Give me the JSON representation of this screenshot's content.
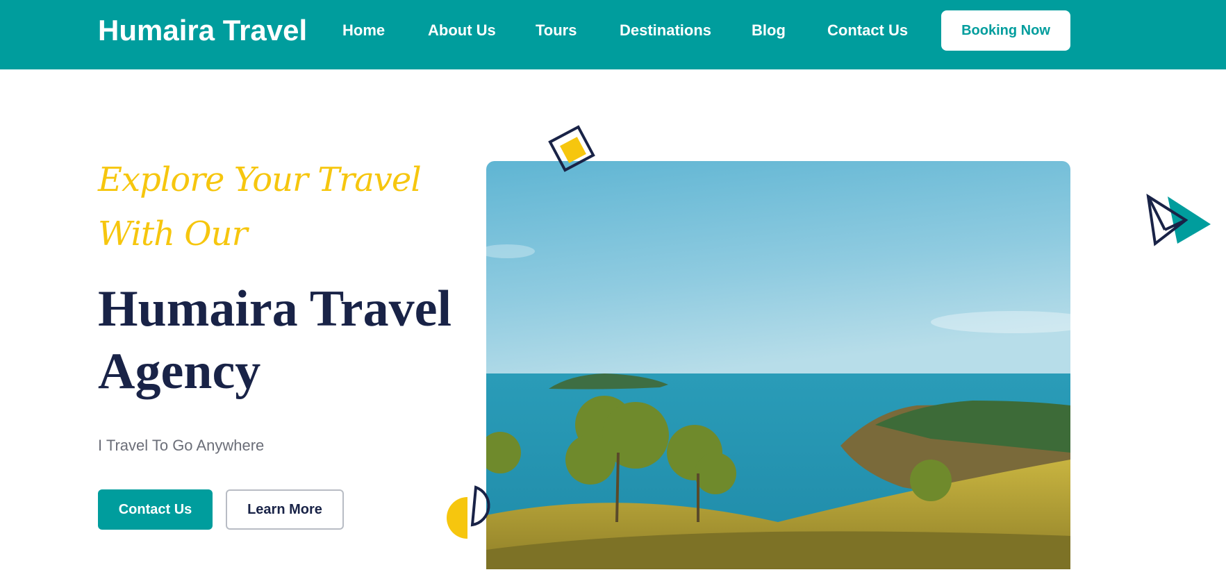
{
  "header": {
    "brand": "Humaira Travel",
    "nav": [
      {
        "label": "Home"
      },
      {
        "label": "About Us"
      },
      {
        "label": "Tours"
      },
      {
        "label": "Destinations"
      },
      {
        "label": "Blog"
      },
      {
        "label": "Contact Us"
      }
    ],
    "cta_label": "Booking Now"
  },
  "hero": {
    "tagline": "Explore Your Travel With Our",
    "headline": "Humaira Travel Agency",
    "subtext": "I Travel To Go Anywhere",
    "primary_button": "Contact Us",
    "secondary_button": "Learn More",
    "image_icon": "coastal-landscape-photo"
  },
  "decorations": {
    "icons": [
      "diamond-icon",
      "half-circle-icon",
      "paper-plane-icon"
    ]
  },
  "colors": {
    "brand_teal": "#009d9d",
    "accent_yellow": "#f6c60e",
    "navy": "#192347",
    "subtext_gray": "#6b6e78"
  }
}
